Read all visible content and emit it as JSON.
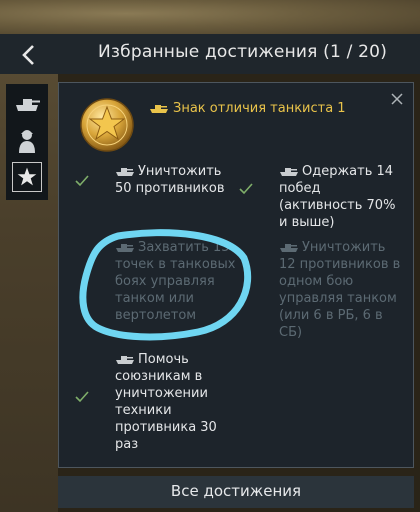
{
  "window": {
    "title": "Избранные достижения (1 / 20)"
  },
  "sidebar": {
    "items": [
      {
        "icon": "tank-icon"
      },
      {
        "icon": "soldier-icon"
      },
      {
        "icon": "star-icon",
        "active": true
      }
    ]
  },
  "achievement": {
    "title": "Знак отличия танкиста 1",
    "medal_icon": "gold-star-medal-icon",
    "accent_color": "#e9c34a",
    "conditions": [
      {
        "text_lines": [
          "Уничтожить",
          "50 противников"
        ],
        "completed": true
      },
      {
        "text_lines": [
          "Одержать 14",
          "побед",
          "(активность 70%",
          "и выше)"
        ],
        "completed": true
      },
      {
        "text_lines": [
          "Захватить 15",
          "точек в танковых",
          "боях управляя",
          "танком или",
          "вертолетом"
        ],
        "completed": false
      },
      {
        "text_lines": [
          "Уничтожить",
          "12 противников в",
          "одном бою",
          "управляя танком",
          "(или 6 в РБ, 6 в",
          "СБ)"
        ],
        "completed": false
      },
      {
        "text_lines": [
          "Помочь",
          "союзникам в",
          "уничтожении",
          "техники",
          "противника 30",
          "раз"
        ],
        "completed": true
      }
    ]
  },
  "footer": {
    "label": "Все достижения"
  },
  "colors": {
    "check": "#7fae6a",
    "annotation": "#6fd6f2"
  }
}
